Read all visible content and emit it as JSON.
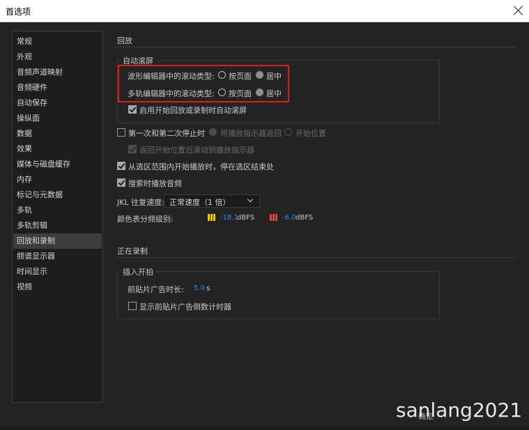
{
  "window": {
    "title": "首选项"
  },
  "sidebar": {
    "items": [
      {
        "label": "常规"
      },
      {
        "label": "外观"
      },
      {
        "label": "音频声道映射"
      },
      {
        "label": "音频硬件"
      },
      {
        "label": "自动保存"
      },
      {
        "label": "操纵面"
      },
      {
        "label": "数据"
      },
      {
        "label": "效果"
      },
      {
        "label": "媒体与磁盘缓存"
      },
      {
        "label": "内存"
      },
      {
        "label": "标记与元数据"
      },
      {
        "label": "多轨"
      },
      {
        "label": "多轨剪辑"
      },
      {
        "label": "回放和录制"
      },
      {
        "label": "频谱显示器"
      },
      {
        "label": "时间显示"
      },
      {
        "label": "视频"
      }
    ],
    "active_index": 13
  },
  "playback": {
    "title": "回放",
    "autoscroll": {
      "legend": "自动滚屏",
      "waveform_label": "波形编辑器中的滚动类型:",
      "multitrack_label": "多轨编辑器中的滚动类型:",
      "option_page": "按页面",
      "option_center": "居中",
      "waveform_selected": "居中",
      "multitrack_selected": "居中",
      "enable_autoscroll_label": "启用开始回放或录制时自动滚屏",
      "enable_autoscroll_checked": true
    },
    "stop_twice_label": "第一次和第二次停止时",
    "stop_twice_checked": false,
    "return_indicator_label": "将播放指示器返回",
    "start_position_label": "开始位置",
    "return_scroll_label": "返回开始位置后滚动到播放指示器",
    "return_scroll_checked": true,
    "play_selection_label": "从选区范围内开始播放时，停在选区结束处",
    "play_selection_checked": true,
    "scrub_label": "搜索时播放音频",
    "scrub_checked": true,
    "jkl_label": "JKL 往复速度:",
    "jkl_value": "正常速度（1 倍）",
    "color_level_label": "颜色表分频级别:",
    "level1_value": "-18.1",
    "level1_unit": "dBFS",
    "level1_color": "#f5c400",
    "level2_value": "-6.0",
    "level2_unit": "dBFS",
    "level2_color": "#e8413c"
  },
  "recording": {
    "title": "正在录制",
    "punch_legend": "插入开拍",
    "preroll_label": "前贴片广告时长:",
    "preroll_value": "5.0",
    "preroll_unit": "s",
    "countdown_label": "显示前贴片广告倒数计时器",
    "countdown_checked": false
  },
  "footer": {
    "watermark": "sanlang2021",
    "ok_button_partial": "确定"
  },
  "colors": {
    "highlight": "#e31b1b",
    "accent_value": "#2d8ceb"
  }
}
